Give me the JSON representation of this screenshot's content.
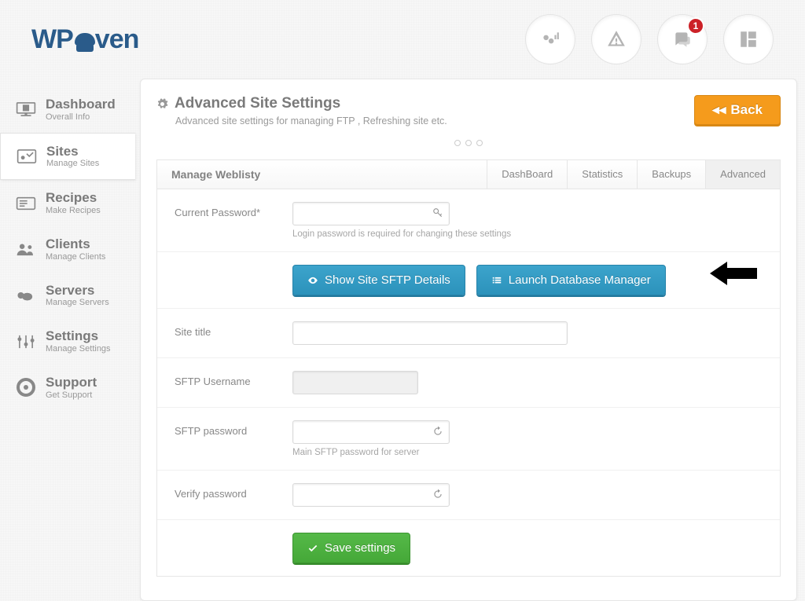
{
  "brand": {
    "logo_text_a": "WP",
    "logo_text_b": "ven"
  },
  "header_badge": "1",
  "sidebar": {
    "items": [
      {
        "title": "Dashboard",
        "subtitle": "Overall Info"
      },
      {
        "title": "Sites",
        "subtitle": "Manage Sites"
      },
      {
        "title": "Recipes",
        "subtitle": "Make Recipes"
      },
      {
        "title": "Clients",
        "subtitle": "Manage Clients"
      },
      {
        "title": "Servers",
        "subtitle": "Manage Servers"
      },
      {
        "title": "Settings",
        "subtitle": "Manage Settings"
      },
      {
        "title": "Support",
        "subtitle": "Get Support"
      }
    ]
  },
  "page": {
    "title": "Advanced Site Settings",
    "subtitle": "Advanced site settings for managing FTP , Refreshing site etc.",
    "back_label": "Back"
  },
  "tabs": {
    "context": "Manage Weblisty",
    "items": [
      "DashBoard",
      "Statistics",
      "Backups",
      "Advanced"
    ],
    "active": "Advanced"
  },
  "form": {
    "current_password": {
      "label": "Current Password*",
      "hint": "Login password is required for changing these settings",
      "value": ""
    },
    "sftp_btn": "Show Site SFTP Details",
    "db_btn": "Launch Database Manager",
    "site_title": {
      "label": "Site title",
      "value": ""
    },
    "sftp_user": {
      "label": "SFTP Username",
      "value": ""
    },
    "sftp_pass": {
      "label": "SFTP password",
      "hint": "Main SFTP password for server",
      "value": ""
    },
    "verify_pass": {
      "label": "Verify password",
      "value": ""
    },
    "save": "Save settings"
  }
}
